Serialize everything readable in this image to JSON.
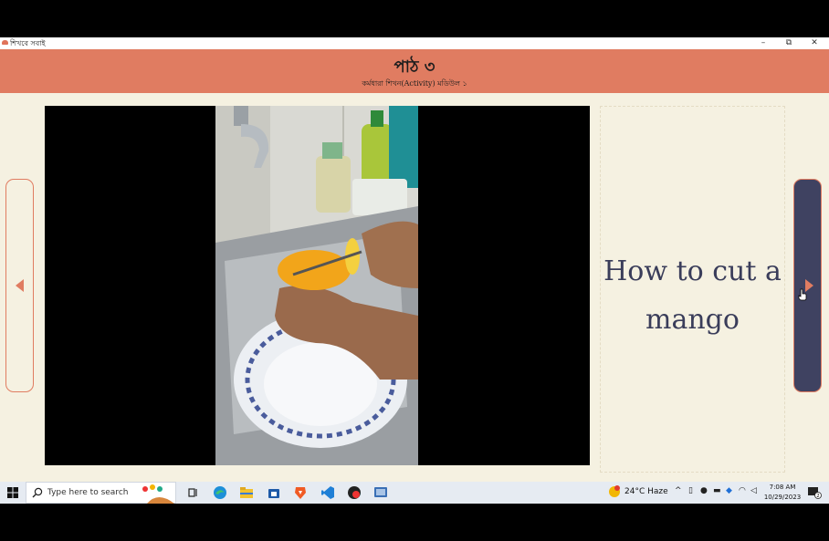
{
  "window": {
    "app_title": "শিখবে সবাই",
    "minimize": "–",
    "maximize": "⧉",
    "close": "✕"
  },
  "header": {
    "title": "পাঠ ৩",
    "subtitle": "কর্মধারা শিখন(Activity) মডিউল ১"
  },
  "content": {
    "caption_line1": "How to cut a",
    "caption_line2": "mango"
  },
  "colors": {
    "header_bg": "#e07c61",
    "content_bg": "#f5f1e1",
    "nav_active_bg": "#3f4261",
    "accent": "#e07c61"
  },
  "taskbar": {
    "search_placeholder": "Type here to search",
    "weather": "24°C  Haze",
    "time": "7:08 AM",
    "date": "10/29/2023",
    "notification_count": "2",
    "apps": [
      "task-view-icon",
      "edge-icon",
      "file-explorer-icon",
      "store-icon",
      "brave-icon",
      "vscode-icon",
      "app-icon",
      "active-app-icon"
    ]
  }
}
